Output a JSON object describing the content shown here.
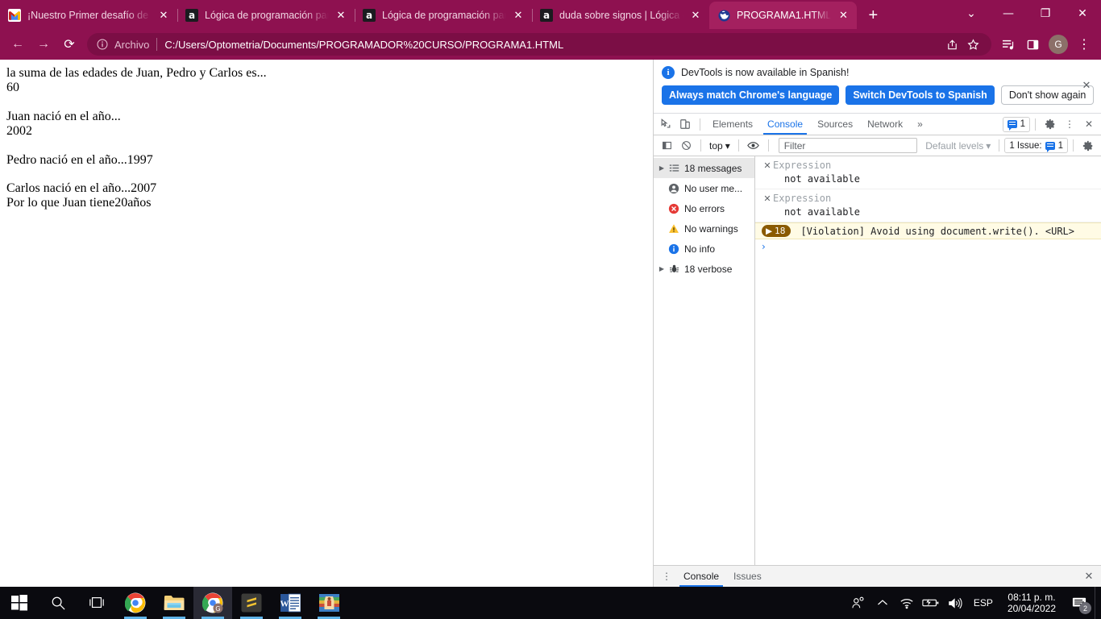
{
  "browser": {
    "tabs": [
      {
        "title": "¡Nuestro Primer desafío de ló",
        "favicon": "gmail-icon",
        "active": false
      },
      {
        "title": "Lógica de programación part",
        "favicon": "platzi-icon",
        "active": false
      },
      {
        "title": "Lógica de programación part",
        "favicon": "platzi-icon",
        "active": false
      },
      {
        "title": "duda sobre signos | Lógica d",
        "favicon": "platzi-icon",
        "active": false
      },
      {
        "title": "PROGRAMA1.HTML",
        "favicon": "globe-icon",
        "active": true
      }
    ],
    "new_tab_label": "+",
    "close_label": "✕",
    "window_controls": {
      "list": "⌄",
      "minimize": "—",
      "maximize": "❐",
      "close": "✕"
    },
    "toolbar": {
      "back": "←",
      "forward": "→",
      "reload": "⟳",
      "scheme_label": "Archivo",
      "url": "C:/Users/Optometria/Documents/PROGRAMADOR%20CURSO/PROGRAMA1.HTML",
      "share_label": "share-icon",
      "bookmark_label": "★",
      "media_label": "media-icon",
      "panel_label": "panel-icon",
      "profile_initial": "G",
      "menu_label": "⋮"
    },
    "accent_color": "#8e1150",
    "active_tab_color": "#a4205f"
  },
  "page": {
    "lines": [
      "la suma de las edades de Juan, Pedro y Carlos es...",
      "60",
      "",
      "Juan nació en el año...",
      "2002",
      "",
      "Pedro nació en el año...1997",
      "",
      "Carlos nació en el año...2007",
      "Por lo que Juan tiene20años"
    ]
  },
  "devtools": {
    "infobar": {
      "message": "DevTools is now available in Spanish!",
      "buttons": [
        {
          "label": "Always match Chrome's language",
          "style": "primary"
        },
        {
          "label": "Switch DevTools to Spanish",
          "style": "primary"
        },
        {
          "label": "Don't show again",
          "style": "secondary"
        }
      ],
      "close": "✕"
    },
    "tabs": [
      {
        "label": "Elements",
        "active": false
      },
      {
        "label": "Console",
        "active": true
      },
      {
        "label": "Sources",
        "active": false
      },
      {
        "label": "Network",
        "active": false
      }
    ],
    "more_tabs_label": "»",
    "message_count": "1",
    "settings_label": "⚙",
    "kebab_label": "⋮",
    "close_label": "✕",
    "filterbar": {
      "sidebar_toggle": "◧",
      "clear_console": "⊘",
      "context": "top",
      "eye": "👁",
      "filter_placeholder": "Filter",
      "levels": "Default levels",
      "issues_text": "1 Issue:",
      "issues_count": "1",
      "settings": "⚙"
    },
    "sidebar": [
      {
        "label": "18 messages",
        "icon": "list-icon",
        "selected": true,
        "expandable": true
      },
      {
        "label": "No user me...",
        "icon": "user-icon",
        "selected": false,
        "expandable": false
      },
      {
        "label": "No errors",
        "icon": "error-icon",
        "selected": false,
        "expandable": false
      },
      {
        "label": "No warnings",
        "icon": "warning-icon",
        "selected": false,
        "expandable": false
      },
      {
        "label": "No info",
        "icon": "info-icon",
        "selected": false,
        "expandable": false
      },
      {
        "label": "18 verbose",
        "icon": "bug-icon",
        "selected": true,
        "expandable": true
      }
    ],
    "messages": [
      {
        "type": "expression",
        "label": "Expression",
        "value": "not available"
      },
      {
        "type": "expression",
        "label": "Expression",
        "value": "not available"
      }
    ],
    "violation": {
      "count": "18",
      "expand": "▶",
      "text": "[Violation] Avoid using document.write(). <URL>"
    },
    "prompt": "›",
    "drawer": {
      "kebab": "⋮",
      "tabs": [
        {
          "label": "Console",
          "active": true
        },
        {
          "label": "Issues",
          "active": false
        }
      ],
      "close": "✕"
    }
  },
  "taskbar": {
    "items": [
      {
        "name": "start-button",
        "icon": "windows-logo-icon"
      },
      {
        "name": "search-button",
        "icon": "search-icon"
      },
      {
        "name": "task-view-button",
        "icon": "task-view-icon"
      },
      {
        "name": "chrome-app",
        "icon": "chrome-icon"
      },
      {
        "name": "file-explorer-app",
        "icon": "folder-icon"
      },
      {
        "name": "chrome-active-app",
        "icon": "chrome-profile-icon"
      },
      {
        "name": "sublime-text-app",
        "icon": "sublime-icon"
      },
      {
        "name": "word-app",
        "icon": "word-icon"
      },
      {
        "name": "winrar-app",
        "icon": "winrar-icon"
      }
    ],
    "tray": {
      "people": "people-icon",
      "chevron": "⌃",
      "wifi": "wifi-icon",
      "battery": "battery-icon",
      "volume": "volume-icon",
      "language": "ESP",
      "time": "08:11 p. m.",
      "date": "20/04/2022",
      "notification_count": "2"
    }
  }
}
